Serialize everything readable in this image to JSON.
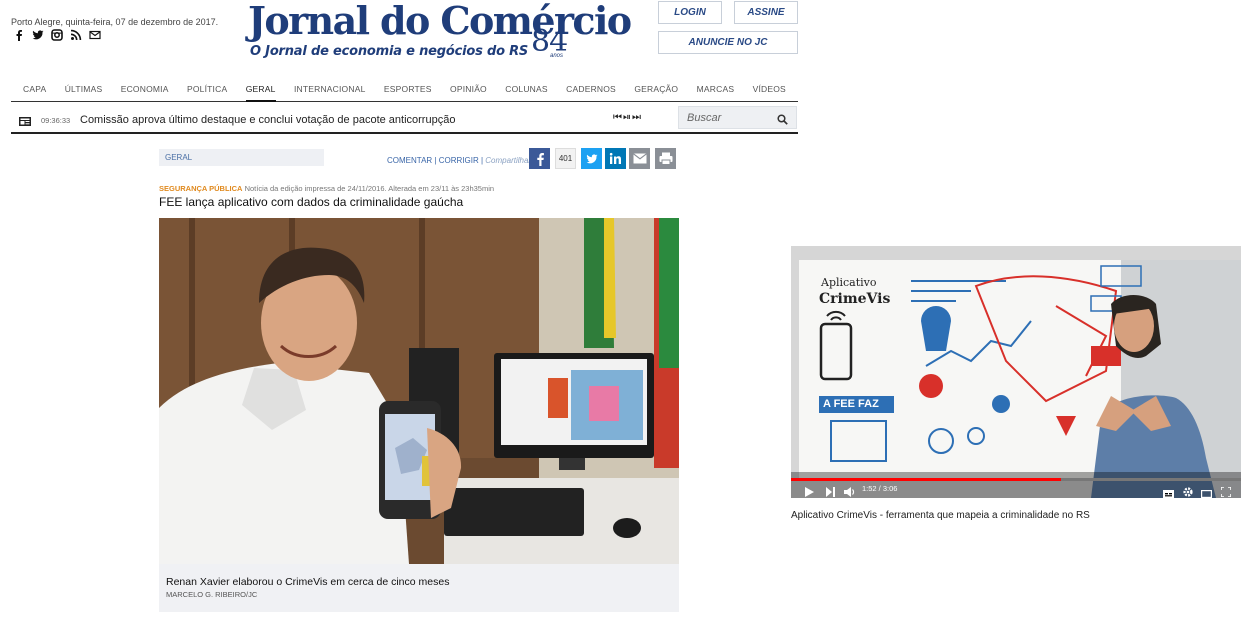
{
  "header": {
    "date": "Porto Alegre, quinta-feira, 07 de dezembro de 2017.",
    "logo_title": "Jornal do Comércio",
    "logo_subtitle": "O Jornal de economia e negócios do RS",
    "logo_years": "84",
    "logo_years_suffix": "anos",
    "login_label": "LOGIN",
    "subscribe_label": "ASSINE",
    "advertise_label": "ANUNCIE NO JC",
    "social_icons": [
      "facebook-icon",
      "twitter-icon",
      "instagram-icon",
      "rss-icon",
      "mail-icon"
    ]
  },
  "nav": {
    "items": [
      "CAPA",
      "ÚLTIMAS",
      "ECONOMIA",
      "POLÍTICA",
      "GERAL",
      "INTERNACIONAL",
      "ESPORTES",
      "OPINIÃO",
      "COLUNAS",
      "CADERNOS",
      "GERAÇÃO",
      "MARCAS",
      "VÍDEOS"
    ],
    "active": "GERAL"
  },
  "ticker": {
    "time": "09:36:33",
    "text": "Comissão aprova último destaque e conclui votação de pacote anticorrupção",
    "controls": "⏮⏯⏭",
    "search_placeholder": "Buscar"
  },
  "article": {
    "section": "GERAL",
    "comment_label": "COMENTAR",
    "separator": "|",
    "correct_label": "CORRIGIR",
    "share_label": "Compartilhar",
    "share_count": "401",
    "category": "SEGURANÇA PÚBLICA",
    "meta": "Notícia da edição impressa de 24/11/2016. Alterada em 23/11 às 23h35min",
    "headline": "FEE lança aplicativo com dados da criminalidade gaúcha",
    "caption": "Renan Xavier elaborou o CrimeVis em cerca de cinco meses",
    "credit": "MARCELO G. RIBEIRO/JC"
  },
  "video": {
    "time": "1:52 / 3:06",
    "progress": 0.6,
    "caption": "Aplicativo CrimeVis - ferramenta que mapeia a criminalidade no RS",
    "board_app_title": "Aplicativo",
    "board_app_name": "CrimeVis",
    "board_fee": "A FEE FAZ"
  },
  "colors": {
    "brand_blue": "#1f3d7a",
    "link_blue": "#3a66a8",
    "category_orange": "#e08a1f",
    "facebook": "#3b5998",
    "twitter": "#1da1f2",
    "linkedin": "#0077b5",
    "youtube_red": "#ff0000"
  }
}
